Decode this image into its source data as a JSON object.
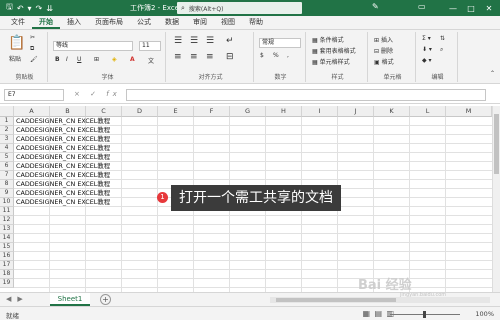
{
  "titlebar": {
    "title": "工作簿2  -  Excel",
    "search_placeholder": "搜索(Alt+Q)",
    "save_icon": "save-icon",
    "undo_icon": "undo-icon",
    "redo_icon": "redo-icon"
  },
  "tabs": [
    "文件",
    "开始",
    "插入",
    "页面布局",
    "公式",
    "数据",
    "审阅",
    "视图",
    "帮助"
  ],
  "active_tab": "开始",
  "ribbon": {
    "clipboard": {
      "label": "剪贴板",
      "paste": "粘贴"
    },
    "font": {
      "label": "字体",
      "name": "等线",
      "size": "11"
    },
    "alignment": {
      "label": "对齐方式"
    },
    "number": {
      "label": "数字",
      "format": "常规"
    },
    "styles": {
      "label": "样式",
      "cond": "条件格式",
      "table": "套用表格格式",
      "cell": "单元格样式"
    },
    "cells": {
      "label": "单元格",
      "insert": "插入",
      "delete": "删除",
      "format": "格式"
    },
    "editing": {
      "label": "编辑"
    }
  },
  "formula_bar": {
    "name_box": "E7",
    "cancel": "×",
    "enter": "✓",
    "fx": "fx",
    "content": ""
  },
  "columns": [
    "A",
    "B",
    "C",
    "D",
    "E",
    "F",
    "G",
    "H",
    "I",
    "J",
    "K",
    "L",
    "M"
  ],
  "rows": [
    "1",
    "2",
    "3",
    "4",
    "5",
    "6",
    "7",
    "8",
    "9",
    "10",
    "11",
    "12",
    "13",
    "14",
    "15",
    "16",
    "17",
    "18",
    "19"
  ],
  "cells_a": [
    "CADDESIGNER_CN EXCEL教程",
    "CADDESIGNER_CN EXCEL教程",
    "CADDESIGNER_CN EXCEL教程",
    "CADDESIGNER_CN EXCEL教程",
    "CADDESIGNER_CN EXCEL教程",
    "CADDESIGNER_CN EXCEL教程",
    "CADDESIGNER_CN EXCEL教程",
    "CADDESIGNER_CN EXCEL教程",
    "CADDESIGNER_CN EXCEL教程",
    "CADDESIGNER_CN EXCEL教程"
  ],
  "sheet_tab": "Sheet1",
  "status": {
    "ready": "就绪",
    "zoom": "100%"
  },
  "annotation": {
    "number": "1",
    "text": "打开一个需工共享的文档"
  },
  "watermark": {
    "main": "Bai 经验",
    "sub": "jingyan.baidu.com"
  }
}
